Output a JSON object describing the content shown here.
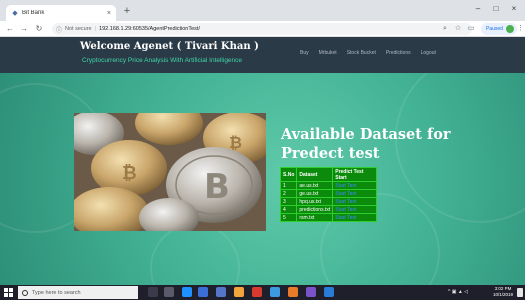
{
  "browser": {
    "tab_title": "Bit Bank",
    "tab_close": "×",
    "new_tab": "+",
    "security_label": "Not secure",
    "url": "192.168.1.29:60535/AgentPredictionTest/",
    "paused_label": "Paused",
    "window_controls": {
      "minimize": "–",
      "maximize": "□",
      "close": "×"
    },
    "icons": {
      "back": "arrow-left-icon",
      "forward": "arrow-right-icon",
      "reload": "reload-icon",
      "info": "info-icon",
      "zoom": "zoom-icon",
      "star": "star-icon",
      "cast": "cast-icon",
      "menu": "kebab-menu-icon"
    }
  },
  "header": {
    "welcome": "Welcome Agenet ( Tivari Khan )",
    "subtitle": "Cryptocurrency Price Analysis With Artificial Intelligence",
    "nav": [
      "Buy",
      "Mrbuket",
      "Stock Bucket",
      "Predictions",
      "Logout"
    ]
  },
  "main": {
    "title": "Available Dataset for Predect test",
    "table": {
      "headers": [
        "S.No",
        "Dataset",
        "Predict Test Start"
      ],
      "rows": [
        {
          "sno": "1",
          "dataset": "ae.us.txt",
          "action": "Start Test"
        },
        {
          "sno": "2",
          "dataset": "ge.us.txt",
          "action": "Start Test"
        },
        {
          "sno": "3",
          "dataset": "hpq.us.txt",
          "action": "Start Test"
        },
        {
          "sno": "4",
          "dataset": "predictions.txt",
          "action": "Start Test"
        },
        {
          "sno": "5",
          "dataset": "rsm.txt",
          "action": "Start Test"
        }
      ]
    }
  },
  "taskbar": {
    "search_placeholder": "Type here to search",
    "clock_time": "3:02 PM",
    "clock_date": "10/1/2019",
    "tray_text": "^ ▣ ▲ ◁"
  },
  "colors": {
    "header_bg": "#2b3a47",
    "subtitle": "#3fd7a8",
    "page_bg": "#44b496",
    "table_bg": "#0b8a0b",
    "link": "#3b8cff"
  }
}
